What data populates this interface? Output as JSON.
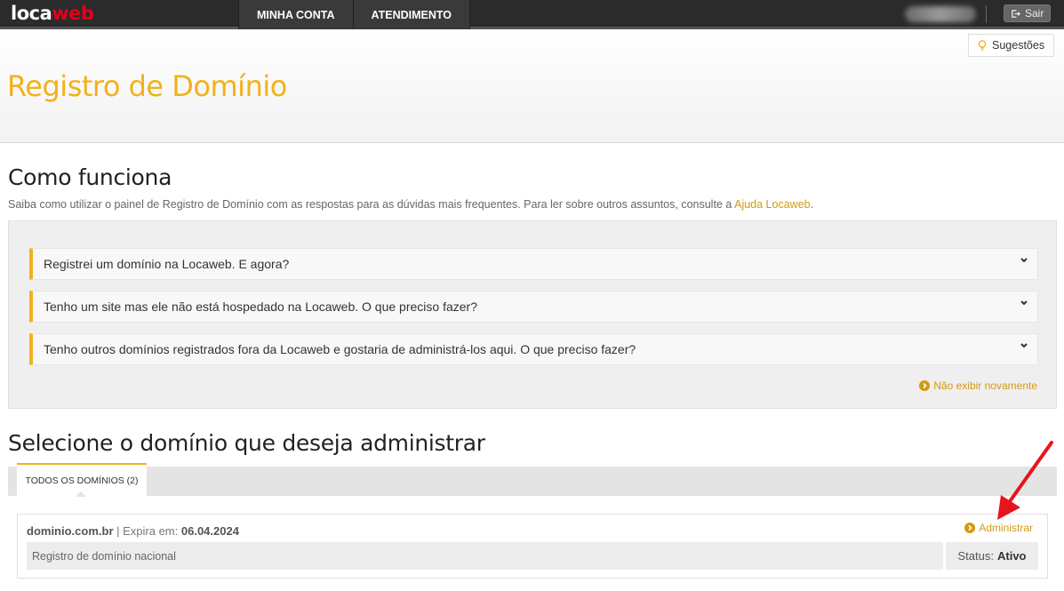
{
  "topbar": {
    "logo_main": "loca",
    "logo_accent": "web",
    "nav": [
      "MINHA CONTA",
      "ATENDIMENTO"
    ],
    "exit_label": "Sair"
  },
  "header": {
    "suggestions_label": "Sugestões",
    "title": "Registro de Domínio"
  },
  "how_it_works": {
    "title": "Como funciona",
    "subtitle_text": "Saiba como utilizar o painel de Registro de Domínio com as respostas para as dúvidas mais frequentes. Para ler sobre outros assuntos, consulte a ",
    "subtitle_link": "Ajuda Locaweb",
    "subtitle_end": ".",
    "faq": [
      "Registrei um domínio na Locaweb. E agora?",
      "Tenho um site mas ele não está hospedado na Locaweb. O que preciso fazer?",
      "Tenho outros domínios registrados fora da Locaweb e gostaria de administrá-los aqui. O que preciso fazer?"
    ],
    "dont_show": "Não exibir novamente"
  },
  "domains": {
    "title": "Selecione o domínio que deseja administrar",
    "tab_label": "TODOS OS DOMÍNIOS (2)",
    "items": [
      {
        "name": "dominio.com.br",
        "separator": " | ",
        "expires_label": "Expira em:",
        "expires_value": "06.04.2024",
        "manage_label": "Administrar",
        "description": "Registro de domínio nacional",
        "status_label": "Status:",
        "status_value": "Ativo"
      }
    ]
  },
  "colors": {
    "accent": "#f4b01b",
    "link": "#d39a0f",
    "topbar": "#2b2b2b",
    "logo_accent": "#e2001a",
    "arrow": "#e8141c"
  }
}
